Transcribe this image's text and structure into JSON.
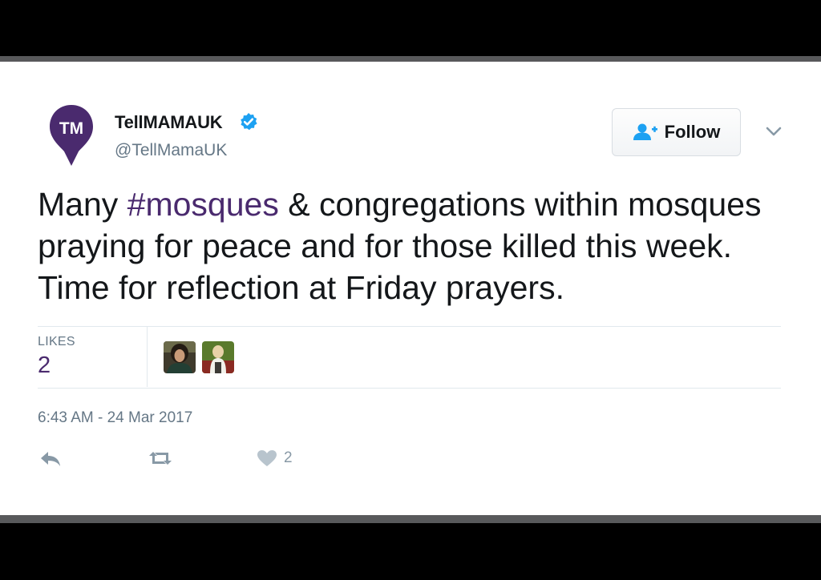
{
  "tweet": {
    "author": {
      "display_name": "TellMAMAUK",
      "handle": "@TellMamaUK",
      "avatar_initials": "TM",
      "verified": true
    },
    "follow_label": "Follow",
    "text": {
      "before": "Many ",
      "hashtag": "#mosques",
      "after": " & congregations within mosques praying for peace and for those killed this week. Time for reflection at Friday prayers."
    },
    "stats": {
      "likes_label": "LIKES",
      "likes_count": "2"
    },
    "timestamp": "6:43 AM - 24 Mar 2017",
    "actions": {
      "like_count": "2"
    }
  },
  "colors": {
    "brand_purple": "#4a2a6e",
    "verified_blue": "#1da1f2",
    "text_dark": "#14171a",
    "text_muted": "#657786"
  },
  "icons": [
    "verified-badge-icon",
    "follow-person-icon",
    "caret-down-icon",
    "reply-icon",
    "retweet-icon",
    "heart-icon"
  ]
}
